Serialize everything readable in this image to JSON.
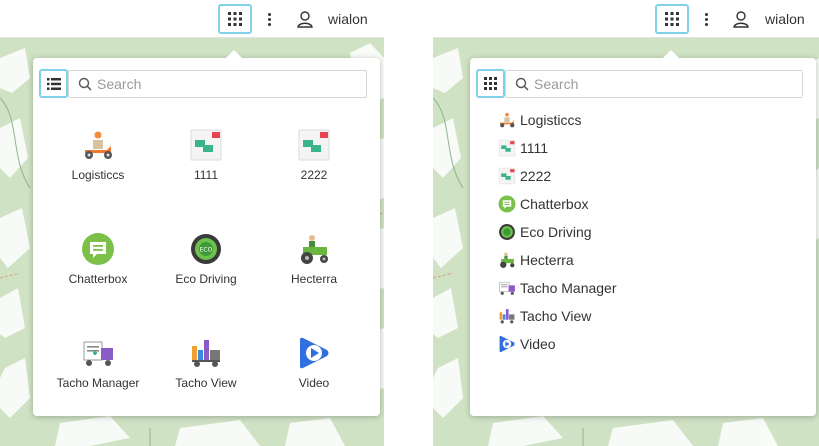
{
  "topbar": {
    "username": "wialon"
  },
  "search": {
    "placeholder": "Search"
  },
  "apps": [
    {
      "label": "Logisticcs",
      "icon": "scooter-courier-icon"
    },
    {
      "label": "1111",
      "icon": "flags-icon"
    },
    {
      "label": "2222",
      "icon": "flags-icon"
    },
    {
      "label": "Chatterbox",
      "icon": "chat-icon"
    },
    {
      "label": "Eco Driving",
      "icon": "eco-wheel-icon"
    },
    {
      "label": "Hecterra",
      "icon": "tractor-icon"
    },
    {
      "label": "Tacho Manager",
      "icon": "tacho-truck-icon"
    },
    {
      "label": "Tacho View",
      "icon": "tacho-chart-truck-icon"
    },
    {
      "label": "Video",
      "icon": "play-icon"
    }
  ]
}
